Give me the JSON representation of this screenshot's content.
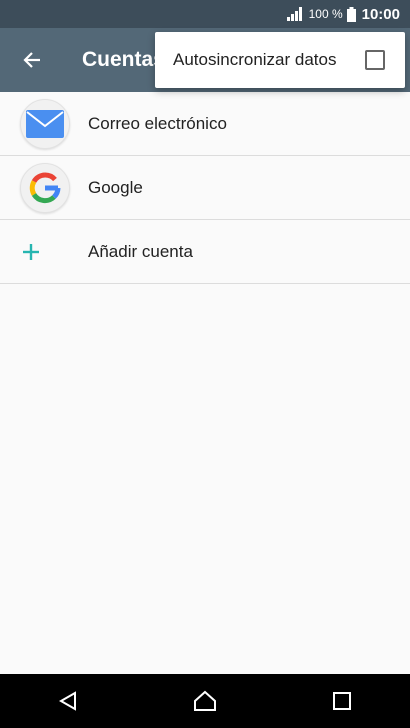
{
  "status_bar": {
    "battery_percent": "100 %",
    "time": "10:00",
    "icons": [
      "signal-icon",
      "battery-icon"
    ]
  },
  "toolbar": {
    "title": "Cuentas",
    "back_icon": "arrow-left-icon"
  },
  "menu": {
    "item_label": "Autosincronizar datos",
    "checked": false
  },
  "accounts": [
    {
      "label": "Correo electrónico",
      "icon": "email-icon"
    },
    {
      "label": "Google",
      "icon": "google-icon"
    }
  ],
  "add_account": {
    "label": "Añadir cuenta",
    "icon": "plus-icon"
  },
  "nav_bar": {
    "icons": [
      "back-triangle-icon",
      "home-icon",
      "recents-icon"
    ]
  },
  "colors": {
    "status_bar_bg": "#3d4d5a",
    "toolbar_bg": "#536877",
    "accent": "#26b5b0",
    "email_blue": "#4a8ff0"
  }
}
